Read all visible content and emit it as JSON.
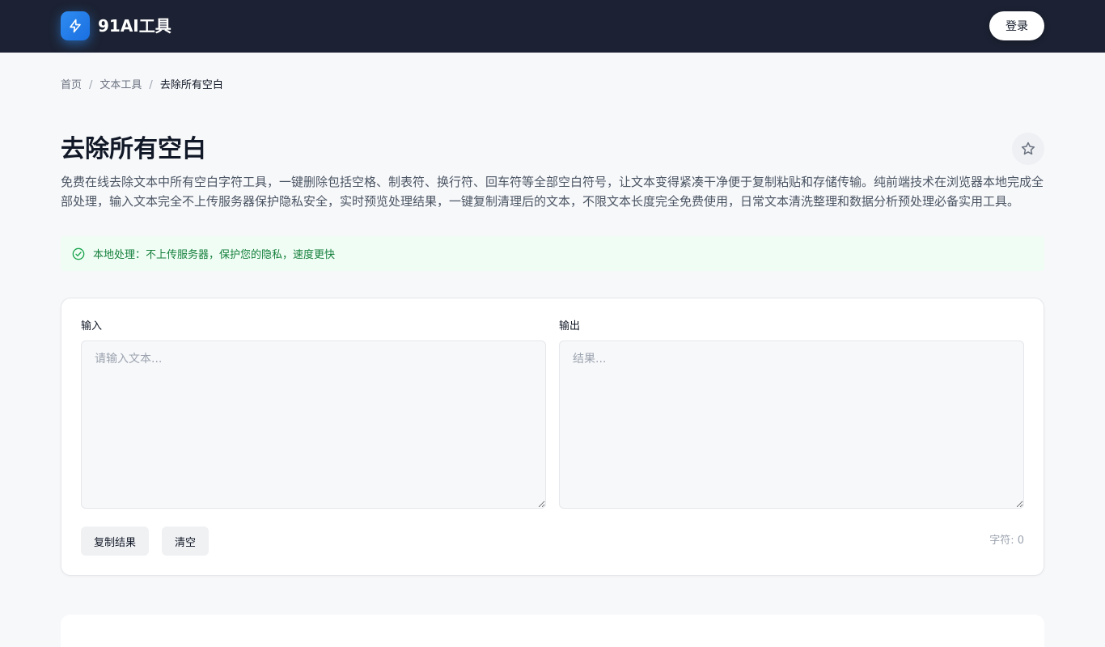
{
  "header": {
    "logo_text": "91AI工具",
    "logo_icon": "lightning-icon",
    "login_label": "登录"
  },
  "breadcrumb": {
    "items": [
      "首页",
      "文本工具",
      "去除所有空白"
    ],
    "separator": "/"
  },
  "page": {
    "title": "去除所有空白",
    "favorite_icon": "star-icon",
    "description": "免费在线去除文本中所有空白字符工具，一键删除包括空格、制表符、换行符、回车符等全部空白符号，让文本变得紧凑干净便于复制粘贴和存储传输。纯前端技术在浏览器本地完成全部处理，输入文本完全不上传服务器保护隐私安全，实时预览处理结果，一键复制清理后的文本，不限文本长度完全免费使用，日常文本清洗整理和数据分析预处理必备实用工具。"
  },
  "notice": {
    "icon": "check-circle-icon",
    "text": "本地处理：不上传服务器，保护您的隐私，速度更快"
  },
  "tool": {
    "input_label": "输入",
    "input_placeholder": "请输入文本...",
    "input_value": "",
    "output_label": "输出",
    "output_placeholder": "结果...",
    "output_value": "",
    "copy_label": "复制结果",
    "clear_label": "清空",
    "char_count": "字符: 0"
  },
  "colors": {
    "header_bg": "#1c2233",
    "accent": "#2f8cf2",
    "notice_bg": "#f0fdf4",
    "notice_text": "#15803d"
  }
}
